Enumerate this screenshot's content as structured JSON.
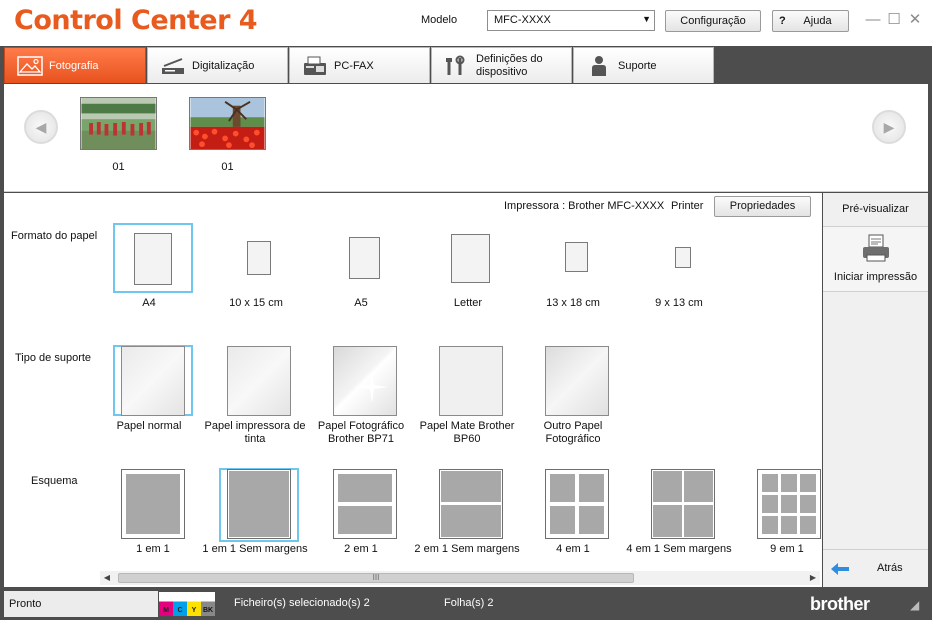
{
  "app": {
    "title": "Control Center 4",
    "model_label": "Modelo",
    "model_value": "MFC-XXXX",
    "config_label": "Configuração",
    "help_label": "Ajuda",
    "help_icon": "?"
  },
  "tabs": [
    {
      "label": "Fotografia",
      "icon": "photo-icon",
      "active": true
    },
    {
      "label": "Digitalização",
      "icon": "scanner-icon",
      "active": false
    },
    {
      "label": "PC-FAX",
      "icon": "fax-icon",
      "active": false
    },
    {
      "label": "Definições do dispositivo",
      "label_line1": "Definições do",
      "label_line2": "dispositivo",
      "icon": "tools-icon",
      "active": false
    },
    {
      "label": "Suporte",
      "icon": "person-icon",
      "active": false
    }
  ],
  "thumbnails": [
    {
      "caption": "01",
      "scene": "marching-band"
    },
    {
      "caption": "01",
      "scene": "tulips-windmill"
    }
  ],
  "printer": {
    "label": "Impressora : Brother MFC-XXXX",
    "kind": "Printer",
    "properties_label": "Propriedades"
  },
  "paper_size": {
    "label": "Formato do papel",
    "selected": "A4",
    "options": [
      "A4",
      "10 x 15 cm",
      "A5",
      "Letter",
      "13 x 18 cm",
      "9 x 13 cm"
    ]
  },
  "media_type": {
    "label": "Tipo de suporte",
    "selected": "Papel normal",
    "options": [
      {
        "line1": "Papel normal",
        "line2": ""
      },
      {
        "line1": "Papel impressora de",
        "line2": "tinta"
      },
      {
        "line1": "Papel Fotográfico",
        "line2": "Brother BP71"
      },
      {
        "line1": "Papel Mate Brother",
        "line2": "BP60"
      },
      {
        "line1": "Outro Papel",
        "line2": "Fotográfico"
      }
    ]
  },
  "layout": {
    "label": "Esquema",
    "selected": "1 em 1 Sem margens",
    "options": [
      "1 em 1",
      "1 em 1 Sem margens",
      "2 em 1",
      "2 em 1 Sem margens",
      "4 em 1",
      "4 em 1 Sem margens",
      "9 em 1"
    ]
  },
  "right_panel": {
    "preview_label": "Pré-visualizar",
    "print_label": "Iniciar impressão",
    "back_label": "Atrás"
  },
  "scrollbar_grip": "III",
  "status": {
    "ready": "Pronto",
    "files": "Ficheiro(s) selecionado(s) 2",
    "sheets": "Folha(s) 2",
    "brand": "brother",
    "ink": [
      {
        "label": "M",
        "color": "#e5007e"
      },
      {
        "label": "C",
        "color": "#00a0e9"
      },
      {
        "label": "Y",
        "color": "#ffe100"
      },
      {
        "label": "BK",
        "color": "#222222"
      }
    ]
  },
  "colors": {
    "accent": "#e8521e",
    "selection": "#6fc6ee"
  }
}
